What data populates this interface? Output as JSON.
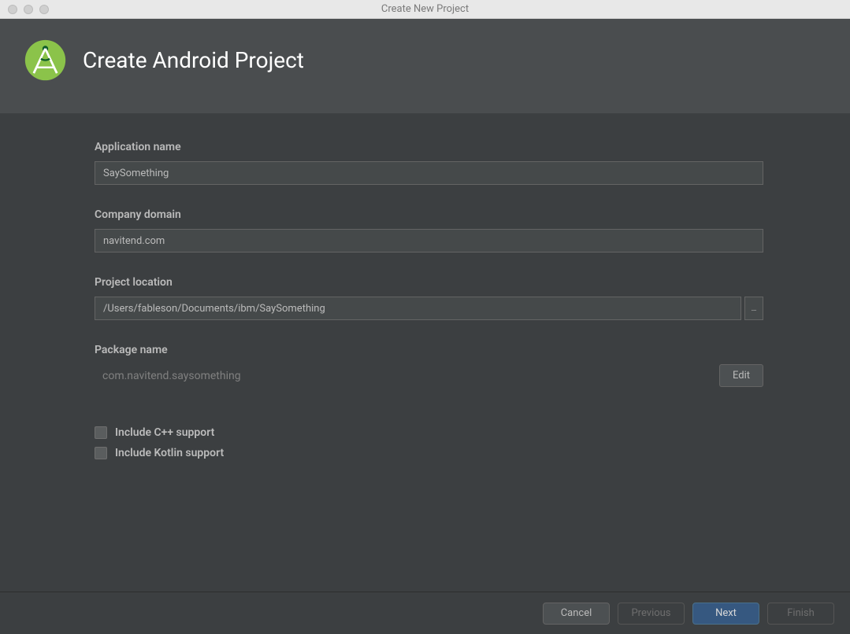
{
  "window": {
    "title": "Create New Project"
  },
  "header": {
    "title": "Create Android Project"
  },
  "form": {
    "application_name": {
      "label": "Application name",
      "value": "SaySomething"
    },
    "company_domain": {
      "label": "Company domain",
      "value": "navitend.com"
    },
    "project_location": {
      "label": "Project location",
      "value": "/Users/fableson/Documents/ibm/SaySomething",
      "browse_label": "…"
    },
    "package_name": {
      "label": "Package name",
      "value": "com.navitend.saysomething",
      "edit_label": "Edit"
    },
    "checkboxes": {
      "cpp": {
        "label": "Include C++ support",
        "checked": false
      },
      "kotlin": {
        "label": "Include Kotlin support",
        "checked": false
      }
    }
  },
  "footer": {
    "cancel": "Cancel",
    "previous": "Previous",
    "next": "Next",
    "finish": "Finish"
  }
}
